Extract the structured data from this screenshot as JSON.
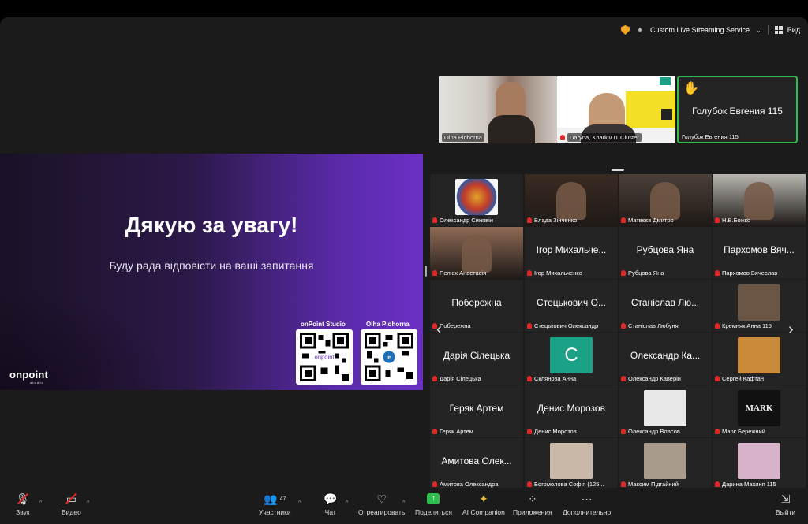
{
  "topbar": {
    "stream_label": "Custom Live Streaming Service",
    "view_label": "Вид"
  },
  "slide": {
    "title": "Дякую за увагу!",
    "subtitle": "Буду рада відповісти на ваші запитання",
    "qr1_label": "onPoint Studio",
    "qr2_label": "Olha Pidhorna",
    "logo": "onpoint",
    "logo_sub": "studio"
  },
  "strip": {
    "tile1_name": "Olha Pidhorna",
    "tile2_name": "Daryna, Kharkiv IT Cluster",
    "hand_big_name": "Голубок Евгения 115",
    "hand_small_name": "Голубок Евгения 115"
  },
  "gallery": [
    {
      "name": "Олександр Синявін",
      "kind": "logo"
    },
    {
      "name": "Влада Зінченко",
      "kind": "video",
      "bg": "#3a2b22"
    },
    {
      "name": "Матвєєв Дмитро",
      "kind": "video",
      "bg": "#4a4038"
    },
    {
      "name": "Н.В.Божко",
      "kind": "video",
      "bg": "#b9b6b0"
    },
    {
      "name": "Пелюх Анастасія",
      "kind": "video",
      "bg": "#8f6a55"
    },
    {
      "name": "Ігор Михальченко",
      "big": "Ігор Михальче..."
    },
    {
      "name": "Рубцова Яна",
      "big": "Рубцова Яна"
    },
    {
      "name": "Пархомов Вячеслав",
      "big": "Пархомов Вяч..."
    },
    {
      "name": "Побережна",
      "big": "Побережна"
    },
    {
      "name": "Стецькович Олександр",
      "big": "Стецькович О..."
    },
    {
      "name": "Станіслав Любуня",
      "big": "Станіслав Лю..."
    },
    {
      "name": "Кремняк Анна 115",
      "kind": "photo",
      "bg": "#6b5544"
    },
    {
      "name": "Дарія Сілецька",
      "big": "Дарія Сілецька"
    },
    {
      "name": "Склянова Анна",
      "kind": "letter",
      "letter": "С"
    },
    {
      "name": "Олександр Каверін",
      "big": "Олександр Ка..."
    },
    {
      "name": "Сергей Кафтан",
      "kind": "photo",
      "bg": "#c98a3a"
    },
    {
      "name": "Геряк Артем",
      "big": "Геряк Артем"
    },
    {
      "name": "Денис Морозов",
      "big": "Денис Морозов"
    },
    {
      "name": "Олександр Власов",
      "kind": "photo",
      "bg": "#e8e8e8"
    },
    {
      "name": "Марк Бережний",
      "kind": "mark",
      "text": "MARK"
    },
    {
      "name": "Амитова Олександра",
      "big": "Амитова Олек..."
    },
    {
      "name": "Богомолова Софія (125...",
      "kind": "photo",
      "bg": "#c9b7a8"
    },
    {
      "name": "Максим Підгайний",
      "kind": "photo",
      "bg": "#a89a8c"
    },
    {
      "name": "Дарина Махиня 115",
      "kind": "photo",
      "bg": "#d6b3c8"
    }
  ],
  "toolbar": {
    "audio": "Звук",
    "video": "Видео",
    "participants": "Участники",
    "participants_count": "47",
    "chat": "Чат",
    "react": "Отреагировать",
    "share": "Поделиться",
    "ai": "AI Companion",
    "apps": "Приложения",
    "more": "Дополнительно",
    "leave": "Выйти"
  }
}
